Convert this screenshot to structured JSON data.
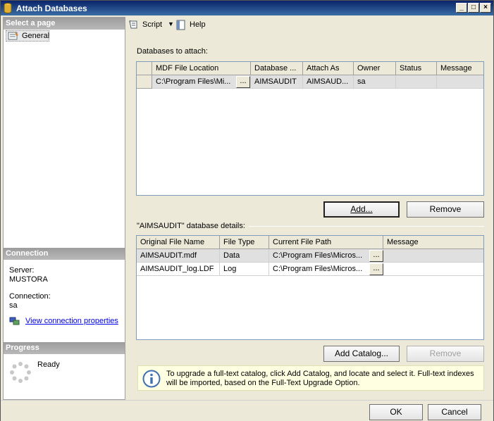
{
  "window": {
    "title": "Attach Databases"
  },
  "left": {
    "select_page_header": "Select a page",
    "pages": [
      {
        "label": "General"
      }
    ],
    "connection_header": "Connection",
    "server_label": "Server:",
    "server_value": "MUSTORA",
    "connection_label": "Connection:",
    "connection_value": "sa",
    "view_props_link": "View connection properties",
    "progress_header": "Progress",
    "progress_status": "Ready"
  },
  "toolbar": {
    "script_label": "Script",
    "help_label": "Help"
  },
  "databases": {
    "group_label": "Databases to attach:",
    "columns": [
      "MDF File Location",
      "Database ...",
      "Attach As",
      "Owner",
      "Status",
      "Message"
    ],
    "rows": [
      {
        "mdf": "C:\\Program Files\\Mi...",
        "database": "AIMSAUDIT",
        "attach_as": "AIMSAUD...",
        "owner": "sa",
        "status": "",
        "message": ""
      }
    ],
    "add_button": "Add...",
    "remove_button": "Remove"
  },
  "details": {
    "group_label": "\"AIMSAUDIT\" database details:",
    "columns": [
      "Original File Name",
      "File Type",
      "Current File Path",
      "Message"
    ],
    "rows": [
      {
        "name": "AIMSAUDIT.mdf",
        "type": "Data",
        "path": "C:\\Program Files\\Micros...",
        "message": ""
      },
      {
        "name": "AIMSAUDIT_log.LDF",
        "type": "Log",
        "path": "C:\\Program Files\\Micros...",
        "message": ""
      }
    ],
    "add_catalog_button": "Add Catalog...",
    "remove_button": "Remove"
  },
  "info": {
    "text": "To upgrade a full-text catalog, click Add Catalog, and locate and select it. Full-text indexes will be imported, based on the Full-Text Upgrade Option."
  },
  "footer": {
    "ok_button": "OK",
    "cancel_button": "Cancel"
  },
  "icons": {
    "app": "database-icon",
    "page": "general-page-icon",
    "script": "script-icon",
    "help": "help-icon",
    "connection": "connection-properties-icon",
    "progress": "progress-spinner-icon",
    "info": "info-icon"
  },
  "colors": {
    "titlebar": "#0a246a",
    "link": "#0000ee",
    "info_bg": "#ffffe1",
    "section_header": "#9c9c9c"
  }
}
